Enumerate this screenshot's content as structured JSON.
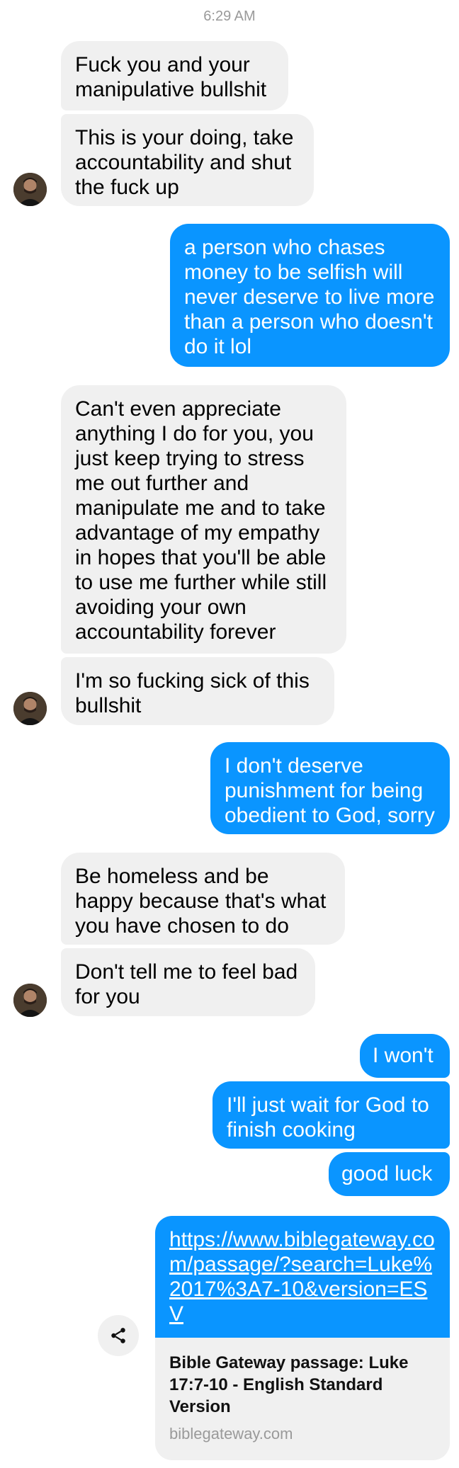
{
  "timestamp": "6:29 AM",
  "messages": [
    {
      "text": "Fuck you and your manipulative bullshit"
    },
    {
      "text": "This is your doing, take accountability and shut the fuck up"
    },
    {
      "text": "a person who chases money to be selfish will never deserve to live more than a person who doesn't do it lol"
    },
    {
      "text": "Can't even appreciate anything I do for you, you just keep trying to stress me out further and manipulate me and to take advantage of my empathy in hopes that you'll be able to use me further while still avoiding your own accountability forever"
    },
    {
      "text": "I'm so fucking sick of this bullshit"
    },
    {
      "text": "I don't deserve punishment for being obedient to God, sorry"
    },
    {
      "text": "Be homeless and be happy because that's what you have chosen to do"
    },
    {
      "text": "Don't tell me to feel bad for you"
    },
    {
      "text": "I won't"
    },
    {
      "text": "I'll just wait for God to finish cooking"
    },
    {
      "text": "good luck"
    }
  ],
  "link_preview": {
    "url": "https://www.biblegateway.com/passage/?search=Luke%2017%3A7-10&version=ESV",
    "title": "Bible Gateway passage: Luke 17:7-10 - English Standard Version",
    "domain": "biblegateway.com"
  },
  "icons": {
    "share": "share-icon",
    "avatar": "contact-avatar"
  },
  "colors": {
    "incoming_bubble": "#f0f0f0",
    "outgoing_bubble": "#0a95ff",
    "timestamp": "#9a9a9a"
  }
}
